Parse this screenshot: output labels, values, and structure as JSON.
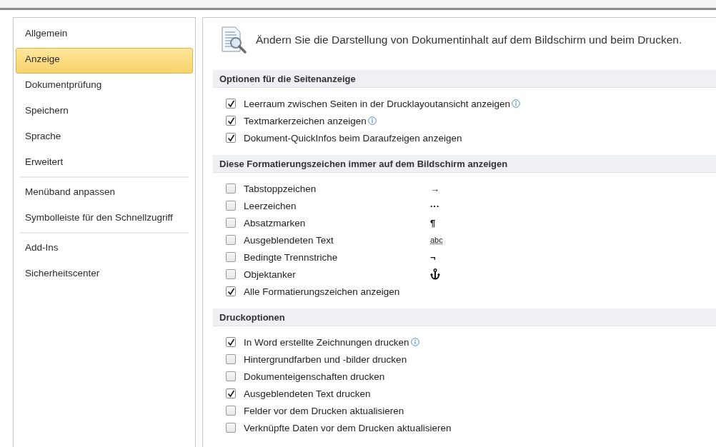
{
  "sidebar": {
    "groups": [
      {
        "items": [
          {
            "label": "Allgemein",
            "selected": false
          },
          {
            "label": "Anzeige",
            "selected": true
          },
          {
            "label": "Dokumentprüfung",
            "selected": false
          },
          {
            "label": "Speichern",
            "selected": false
          },
          {
            "label": "Sprache",
            "selected": false
          },
          {
            "label": "Erweitert",
            "selected": false
          }
        ]
      },
      {
        "items": [
          {
            "label": "Menüband anpassen",
            "selected": false
          },
          {
            "label": "Symbolleiste für den Schnellzugriff",
            "selected": false
          }
        ]
      },
      {
        "items": [
          {
            "label": "Add-Ins",
            "selected": false
          },
          {
            "label": "Sicherheitscenter",
            "selected": false
          }
        ]
      }
    ]
  },
  "header": {
    "text": "Ändern Sie die Darstellung von Dokumentinhalt auf dem Bildschirm und beim Drucken."
  },
  "sections": [
    {
      "title": "Optionen für die Seitenanzeige",
      "options": [
        {
          "kind": "plain",
          "label": "Leerraum zwischen Seiten in der Drucklayoutansicht anzeigen",
          "checked": true,
          "info": true
        },
        {
          "kind": "plain",
          "label": "Textmarkerzeichen anzeigen",
          "checked": true,
          "info": true
        },
        {
          "kind": "plain",
          "label": "Dokument-QuickInfos beim Daraufzeigen anzeigen",
          "checked": true,
          "info": false
        }
      ]
    },
    {
      "title": "Diese Formatierungszeichen immer auf dem Bildschirm anzeigen",
      "options": [
        {
          "kind": "symbol",
          "label": "Tabstoppzeichen",
          "checked": false,
          "info": false,
          "symbol": "→"
        },
        {
          "kind": "symbol",
          "label": "Leerzeichen",
          "checked": false,
          "info": false,
          "symbol": "···"
        },
        {
          "kind": "symbol",
          "label": "Absatzmarken",
          "checked": false,
          "info": false,
          "symbol": "¶"
        },
        {
          "kind": "hidden",
          "label": "Ausgeblendeten Text",
          "checked": false,
          "info": false,
          "symbol": "abc"
        },
        {
          "kind": "symbol",
          "label": "Bedingte Trennstriche",
          "checked": false,
          "info": false,
          "symbol": "¬"
        },
        {
          "kind": "anchor",
          "label": "Objektanker",
          "checked": false,
          "info": false
        },
        {
          "kind": "plain",
          "label": "Alle Formatierungszeichen anzeigen",
          "checked": true,
          "info": false
        }
      ]
    },
    {
      "title": "Druckoptionen",
      "options": [
        {
          "kind": "plain",
          "label": "In Word erstellte Zeichnungen drucken",
          "checked": true,
          "info": true
        },
        {
          "kind": "plain",
          "label": "Hintergrundfarben und -bilder drucken",
          "checked": false,
          "info": false
        },
        {
          "kind": "plain",
          "label": "Dokumenteigenschaften drucken",
          "checked": false,
          "info": false
        },
        {
          "kind": "plain",
          "label": "Ausgeblendeten Text drucken",
          "checked": true,
          "info": false
        },
        {
          "kind": "plain",
          "label": "Felder vor dem Drucken aktualisieren",
          "checked": false,
          "info": false
        },
        {
          "kind": "plain",
          "label": "Verknüpfte Daten vor dem Drucken aktualisieren",
          "checked": false,
          "info": false
        }
      ]
    }
  ]
}
